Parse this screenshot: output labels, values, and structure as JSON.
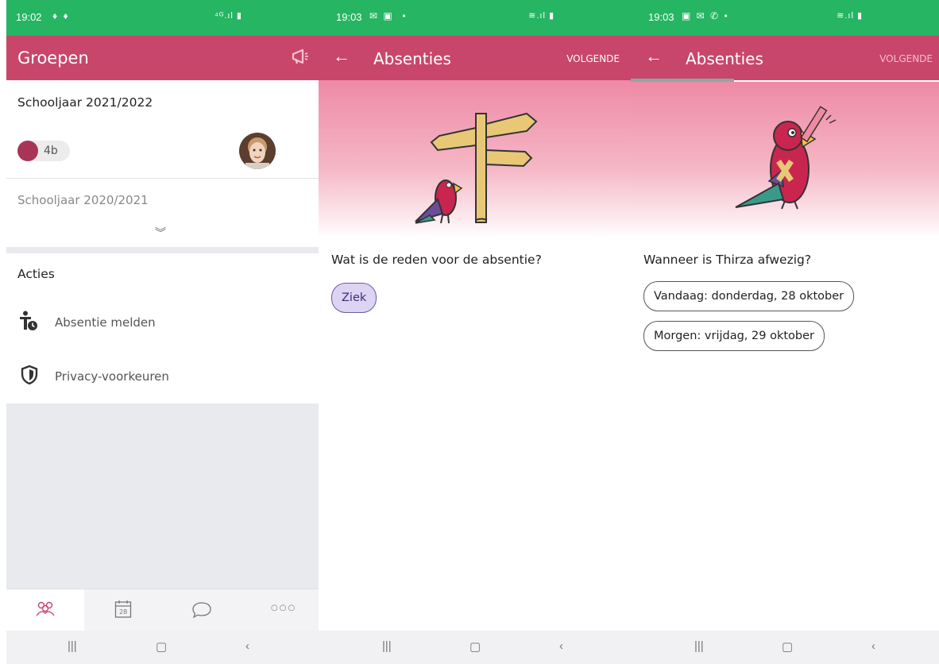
{
  "colors": {
    "statusbar": "#26b563",
    "appbar": "#c8466a",
    "chip_dot": "#a83458",
    "selected_chip": "#ddd3f3"
  },
  "panel1": {
    "status_time": "19:02",
    "title": "Groepen",
    "year_current": "Schooljaar 2021/2022",
    "group_label": "4b",
    "year_previous": "Schooljaar 2020/2021",
    "actions_header": "Acties",
    "actions": [
      {
        "label": "Absentie melden",
        "icon": "absence-icon"
      },
      {
        "label": "Privacy-voorkeuren",
        "icon": "shield-icon"
      }
    ],
    "bottom_tabs": [
      {
        "icon": "groups-icon"
      },
      {
        "icon": "calendar-icon",
        "day": "28"
      },
      {
        "icon": "chat-icon"
      },
      {
        "icon": "more-icon"
      }
    ]
  },
  "panel2": {
    "status_time": "19:03",
    "title": "Absenties",
    "next_label": "VOLGENDE",
    "question": "Wat is de reden voor de absentie?",
    "options": [
      "Ziek"
    ]
  },
  "panel3": {
    "status_time": "19:03",
    "title": "Absenties",
    "next_label": "VOLGENDE",
    "question": "Wanneer is Thirza afwezig?",
    "options": [
      "Vandaag: donderdag, 28 oktober",
      "Morgen: vrijdag, 29 oktober"
    ]
  }
}
